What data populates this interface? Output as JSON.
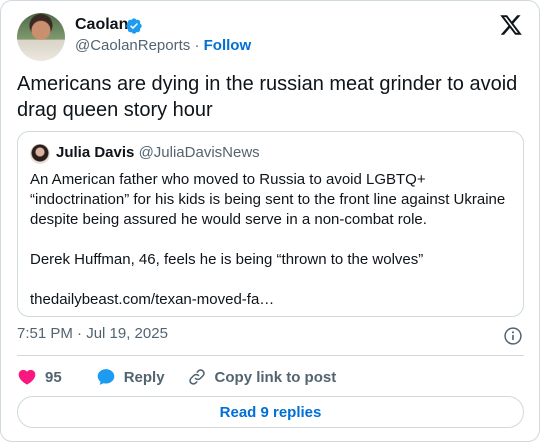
{
  "author": {
    "name": "Caolan",
    "handle": "@CaolanReports",
    "separator": "·",
    "follow_label": "Follow"
  },
  "tweet": {
    "text": "Americans are dying in the russian meat grinder to avoid drag queen story hour",
    "timestamp": "7:51 PM · Jul 19, 2025"
  },
  "quote": {
    "name": "Julia Davis",
    "handle": "@JuliaDavisNews",
    "paragraph1": "An American father who moved to Russia to avoid LGBTQ+ “indoctrination” for his kids is being sent to the front line against Ukraine despite being assured he would serve in a non-combat role.",
    "paragraph2": "Derek Huffman, 46, feels he is being “thrown to the wolves”",
    "link": "thedailybeast.com/texan-moved-fa…"
  },
  "actions": {
    "like_count": "95",
    "reply_label": "Reply",
    "copy_label": "Copy link to post"
  },
  "read_replies_label": "Read 9 replies",
  "icons": {
    "verified": "verified-badge-icon",
    "x_logo": "x-logo-icon",
    "info": "info-icon",
    "heart": "heart-icon",
    "reply": "reply-bubble-icon",
    "link": "link-icon"
  },
  "colors": {
    "accent": "#006fd6",
    "verified": "#1d9bf0",
    "heart": "#f91880",
    "text": "#0f1419",
    "secondary": "#536471",
    "border": "#cfd9de"
  }
}
